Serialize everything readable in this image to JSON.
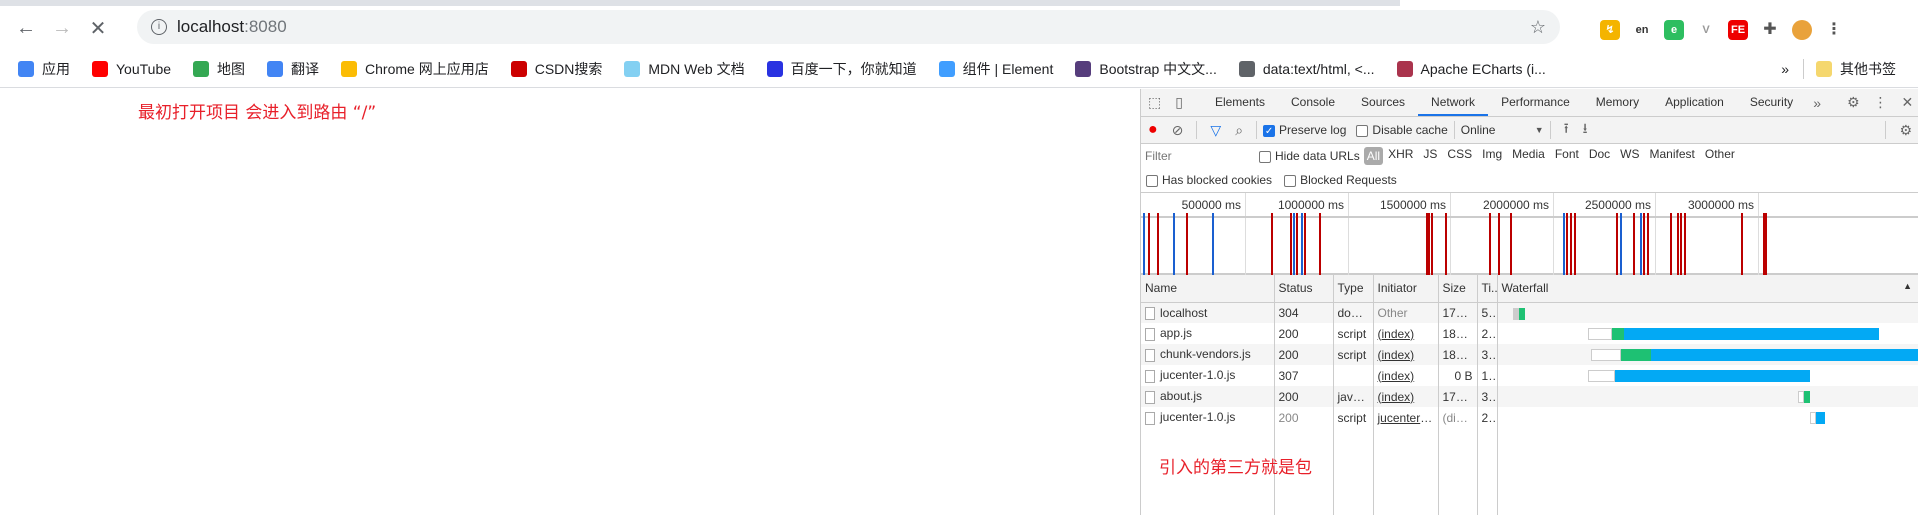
{
  "browser": {
    "url_host": "localhost",
    "url_port": ":8080",
    "bookmarks": [
      {
        "label": "应用",
        "icon": "apps-grid-icon",
        "color": "#4285f4"
      },
      {
        "label": "YouTube",
        "icon": "youtube-icon",
        "color": "#ff0000"
      },
      {
        "label": "地图",
        "icon": "maps-icon",
        "color": "#34a853"
      },
      {
        "label": "翻译",
        "icon": "translate-icon",
        "color": "#4285f4"
      },
      {
        "label": "Chrome 网上应用店",
        "icon": "webstore-icon",
        "color": "#fbbc05"
      },
      {
        "label": "CSDN搜索",
        "icon": "csdn-icon",
        "color": "#c00"
      },
      {
        "label": "MDN Web 文档",
        "icon": "mdn-icon",
        "color": "#83d0f2"
      },
      {
        "label": "百度一下，你就知道",
        "icon": "baidu-icon",
        "color": "#2932e1"
      },
      {
        "label": "组件 | Element",
        "icon": "element-icon",
        "color": "#409eff"
      },
      {
        "label": "Bootstrap 中文文...",
        "icon": "bootstrap-icon",
        "color": "#563d7c"
      },
      {
        "label": "data:text/html, <...",
        "icon": "globe-icon",
        "color": "#5f6368"
      },
      {
        "label": "Apache ECharts (i...",
        "icon": "echarts-icon",
        "color": "#aa344d"
      }
    ],
    "more": "»",
    "other_bookmarks": "其他书签"
  },
  "annotations": {
    "top": "最初打开项目 会进入到路由 “/”",
    "bottom": "引入的第三方就是包"
  },
  "devtools": {
    "tabs": [
      "Elements",
      "Console",
      "Sources",
      "Network",
      "Performance",
      "Memory",
      "Application",
      "Security"
    ],
    "active_tab": "Network",
    "preserve_log": "Preserve log",
    "preserve_checked": true,
    "disable_cache": "Disable cache",
    "throttle": "Online",
    "filter_placeholder": "Filter",
    "hide_data_urls": "Hide data URLs",
    "filter_types": [
      "All",
      "XHR",
      "JS",
      "CSS",
      "Img",
      "Media",
      "Font",
      "Doc",
      "WS",
      "Manifest",
      "Other"
    ],
    "has_blocked_cookies": "Has blocked cookies",
    "blocked_requests": "Blocked Requests",
    "ticks": [
      "500000 ms",
      "1000000 ms",
      "1500000 ms",
      "2000000 ms",
      "2500000 ms",
      "3000000 ms"
    ],
    "columns": [
      "Name",
      "Status",
      "Type",
      "Initiator",
      "Size",
      "Ti...",
      "Waterfall"
    ],
    "rows": [
      {
        "name": "localhost",
        "status": "304",
        "type": "docum...",
        "initiator": "Other",
        "size": "178 B",
        "time": "5 ..."
      },
      {
        "name": "app.js",
        "status": "200",
        "type": "script",
        "initiator": "(index)",
        "size": "181 B",
        "time": "2..."
      },
      {
        "name": "chunk-vendors.js",
        "status": "200",
        "type": "script",
        "initiator": "(index)",
        "size": "181 B",
        "time": "3..."
      },
      {
        "name": "jucenter-1.0.js",
        "status": "307",
        "type": "",
        "initiator": "(index)",
        "size": "0 B",
        "time": "1..."
      },
      {
        "name": "about.js",
        "status": "200",
        "type": "javascript",
        "initiator": "(index)",
        "size": "179 B",
        "time": "3 ..."
      },
      {
        "name": "jucenter-1.0.js",
        "status": "200",
        "type": "script",
        "initiator": "jucenter-1.0.js",
        "size": "(disk ca...",
        "time": "2 ..."
      }
    ]
  }
}
